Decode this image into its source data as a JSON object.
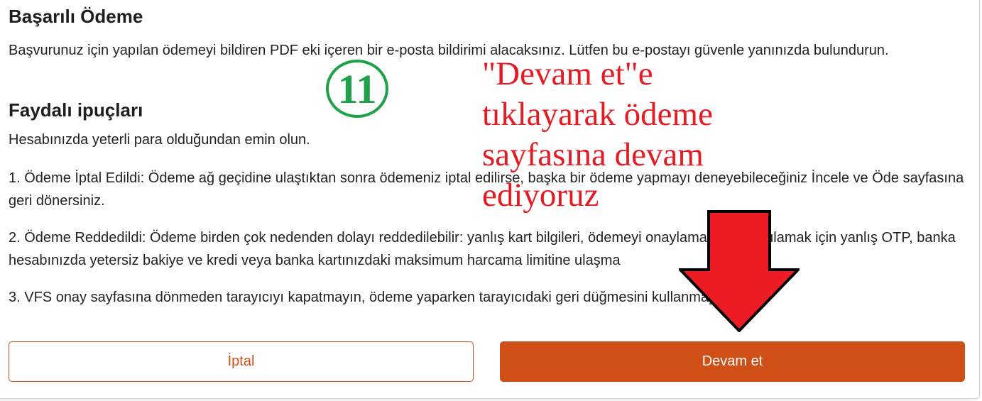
{
  "success": {
    "title": "Başarılı Ödeme",
    "description": "Başvurunuz için yapılan ödemeyi bildiren PDF eki içeren bir e-posta bildirimi alacaksınız. Lütfen bu e-postayı güvenle yanınızda bulundurun."
  },
  "tips": {
    "title": "Faydalı ipuçları",
    "intro": "Hesabınızda yeterli para olduğundan emin olun.",
    "items": [
      "1. Ödeme İptal Edildi: Ödeme ağ geçidine ulaştıktan sonra ödemeniz iptal edilirse, başka bir ödeme yapmayı deneyebileceğiniz İncele ve Öde sayfasına geri dönersiniz.",
      "2. Ödeme Reddedildi: Ödeme birden çok nedenden dolayı reddedilebilir: yanlış kart bilgileri, ödemeyi onaylamak ve doğrulamak için yanlış OTP, banka hesabınızda yetersiz bakiye ve kredi veya banka kartınızdaki maksimum harcama limitine ulaşma",
      "3. VFS onay sayfasına dönmeden tarayıcıyı kapatmayın, ödeme yaparken tarayıcıdaki geri düğmesini kullanmayın."
    ]
  },
  "buttons": {
    "cancel_label": "İptal",
    "continue_label": "Devam et"
  },
  "annotation": {
    "step_number": "11",
    "lines": [
      "\"Devam et\"e",
      "tıklayarak ödeme",
      "sayfasına devam",
      "ediyoruz"
    ]
  },
  "colors": {
    "accent": "#d04f17",
    "annotation_text": "#e41b23",
    "step_badge": "#1fa14a",
    "arrow_fill": "#ed1c24"
  },
  "icons": {
    "arrow": "down-arrow-icon"
  }
}
